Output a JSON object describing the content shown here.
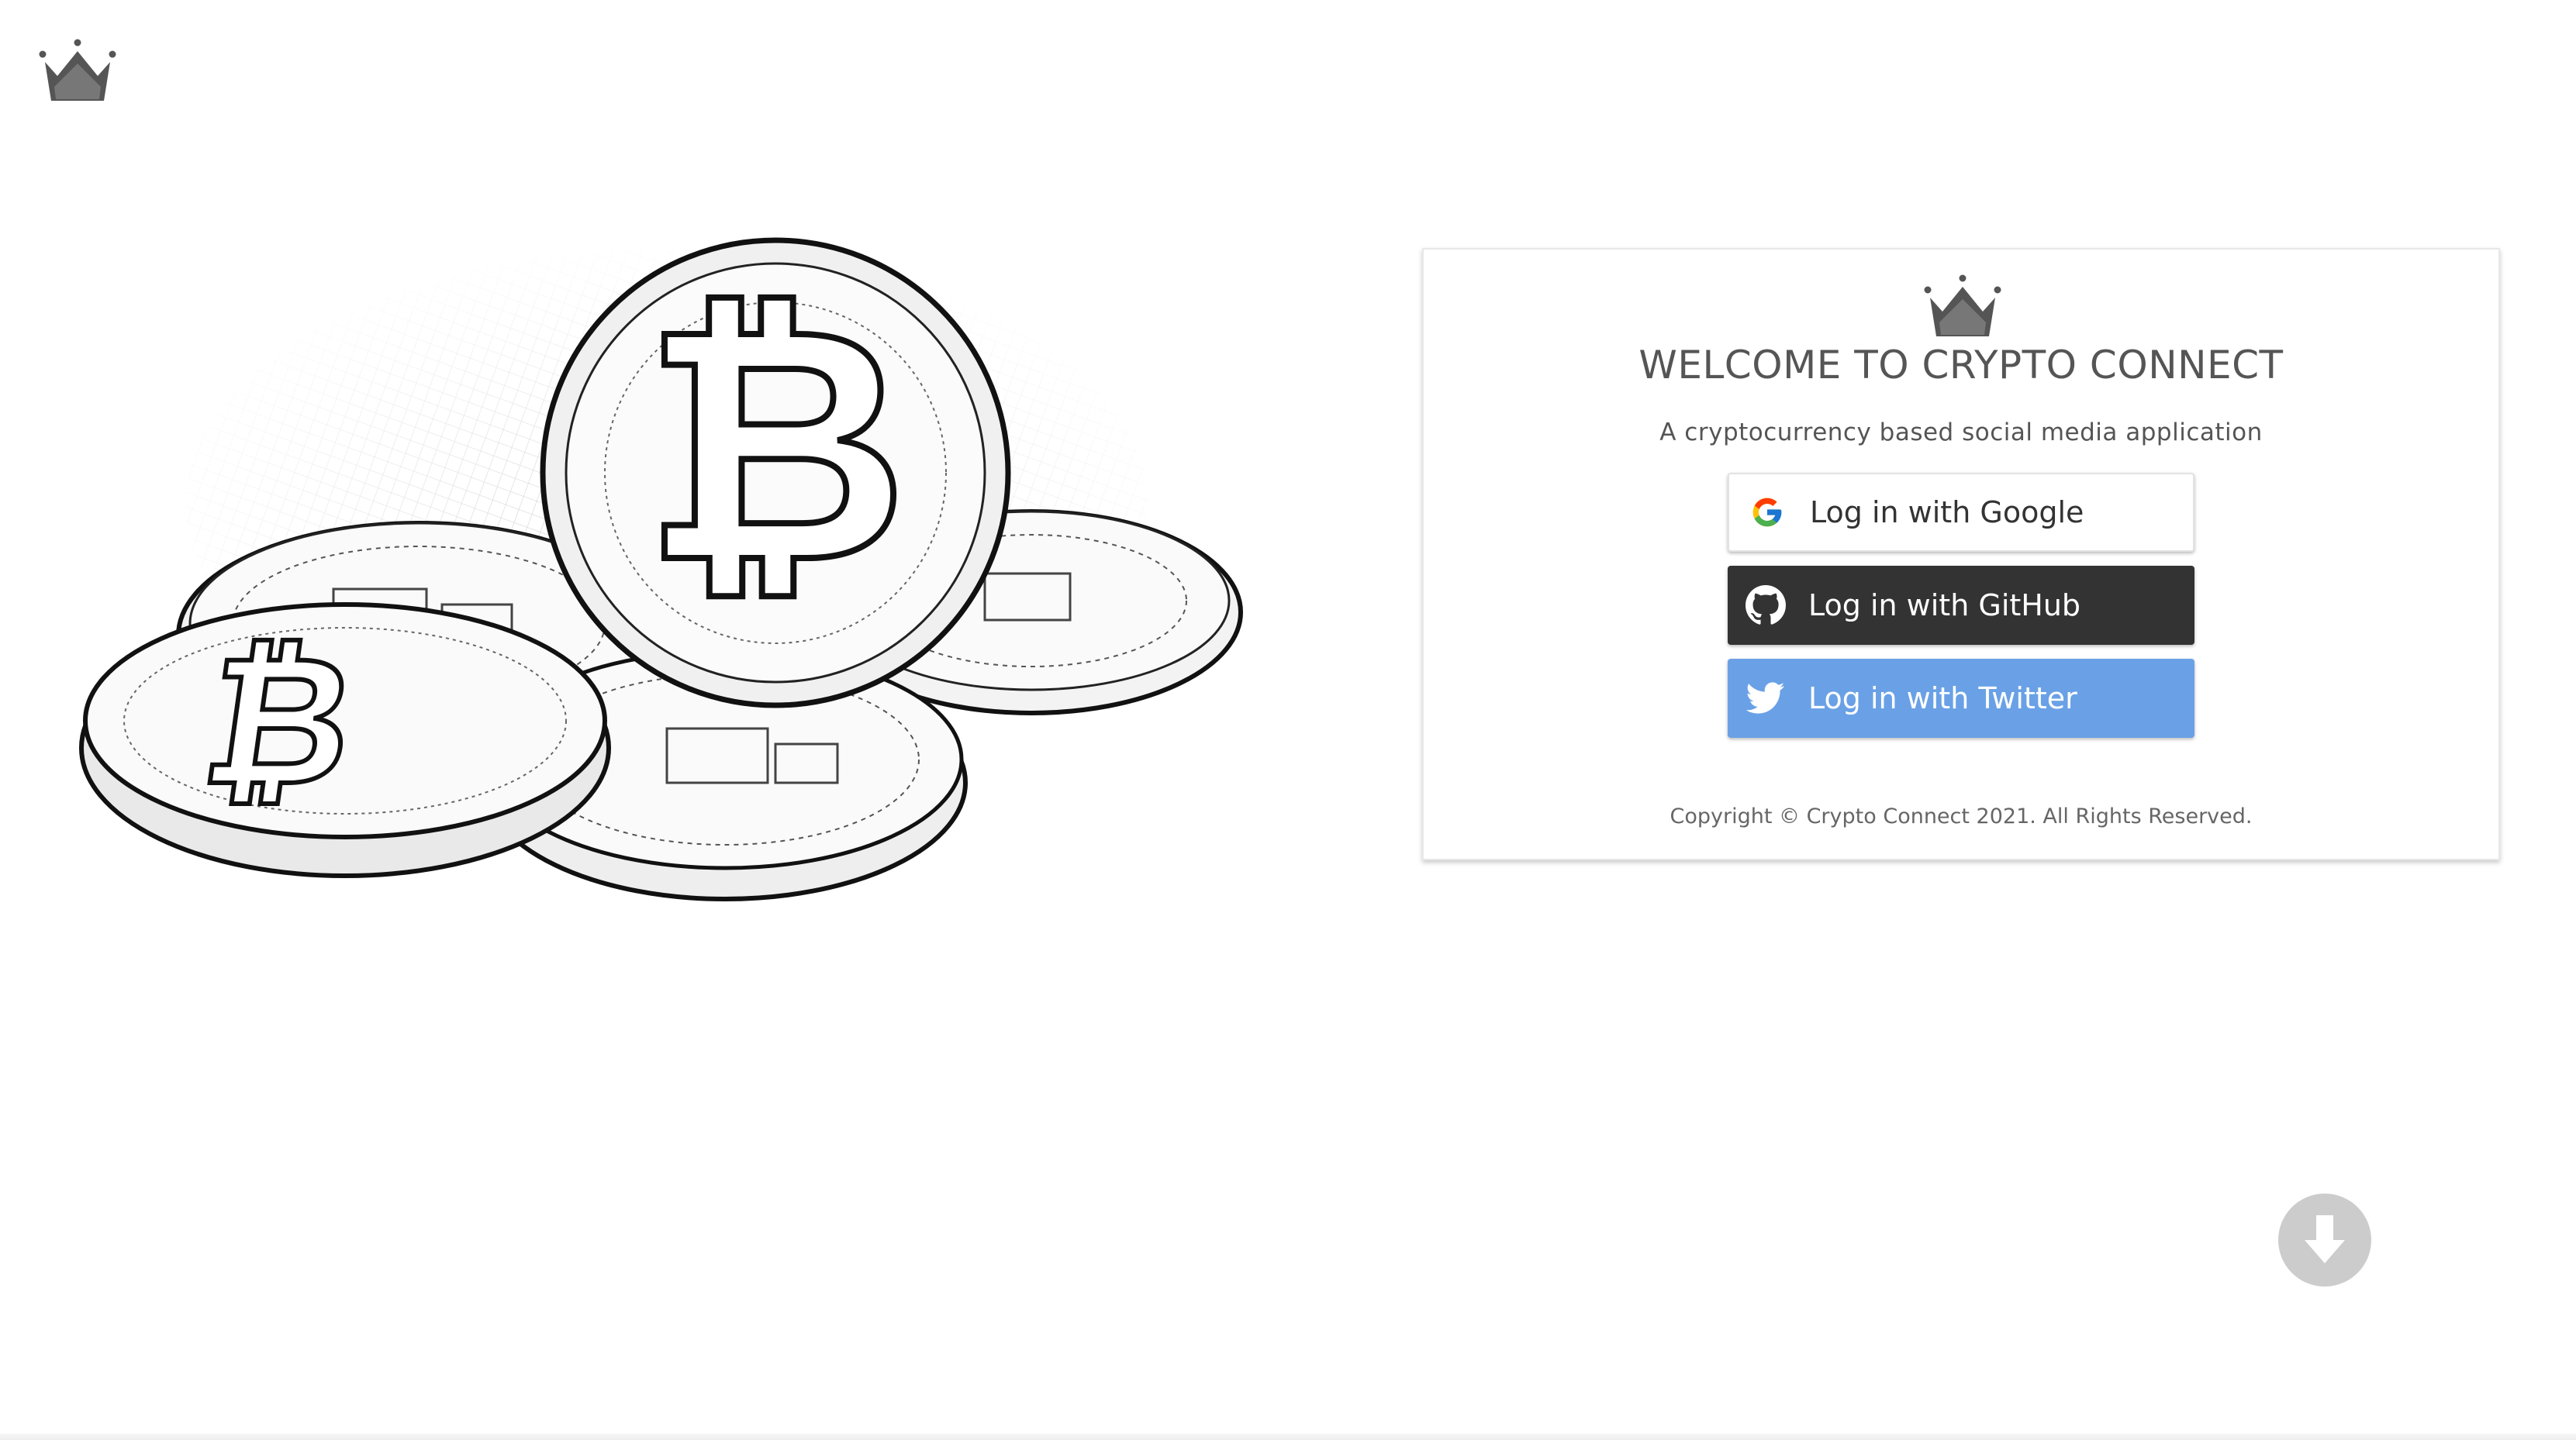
{
  "app": {
    "logo_icon": "crown-icon"
  },
  "hero": {
    "image": "bitcoin-coins-sketch"
  },
  "card": {
    "logo_icon": "crown-icon",
    "title": "WELCOME TO CRYPTO CONNECT",
    "subtitle": "A cryptocurrency based social media application",
    "buttons": [
      {
        "label": "Log in with Google",
        "icon": "google-icon",
        "background": "#ffffff",
        "color": "#333333"
      },
      {
        "label": "Log in with GitHub",
        "icon": "github-icon",
        "background": "#333333",
        "color": "#ffffff"
      },
      {
        "label": "Log in with Twitter",
        "icon": "twitter-icon",
        "background": "#6aa1e6",
        "color": "#ffffff"
      }
    ],
    "copyright": "Copyright © Crypto Connect 2021. All Rights Reserved."
  },
  "scroll_down": {
    "icon": "arrow-down-circle-icon",
    "color": "#cccccc"
  }
}
